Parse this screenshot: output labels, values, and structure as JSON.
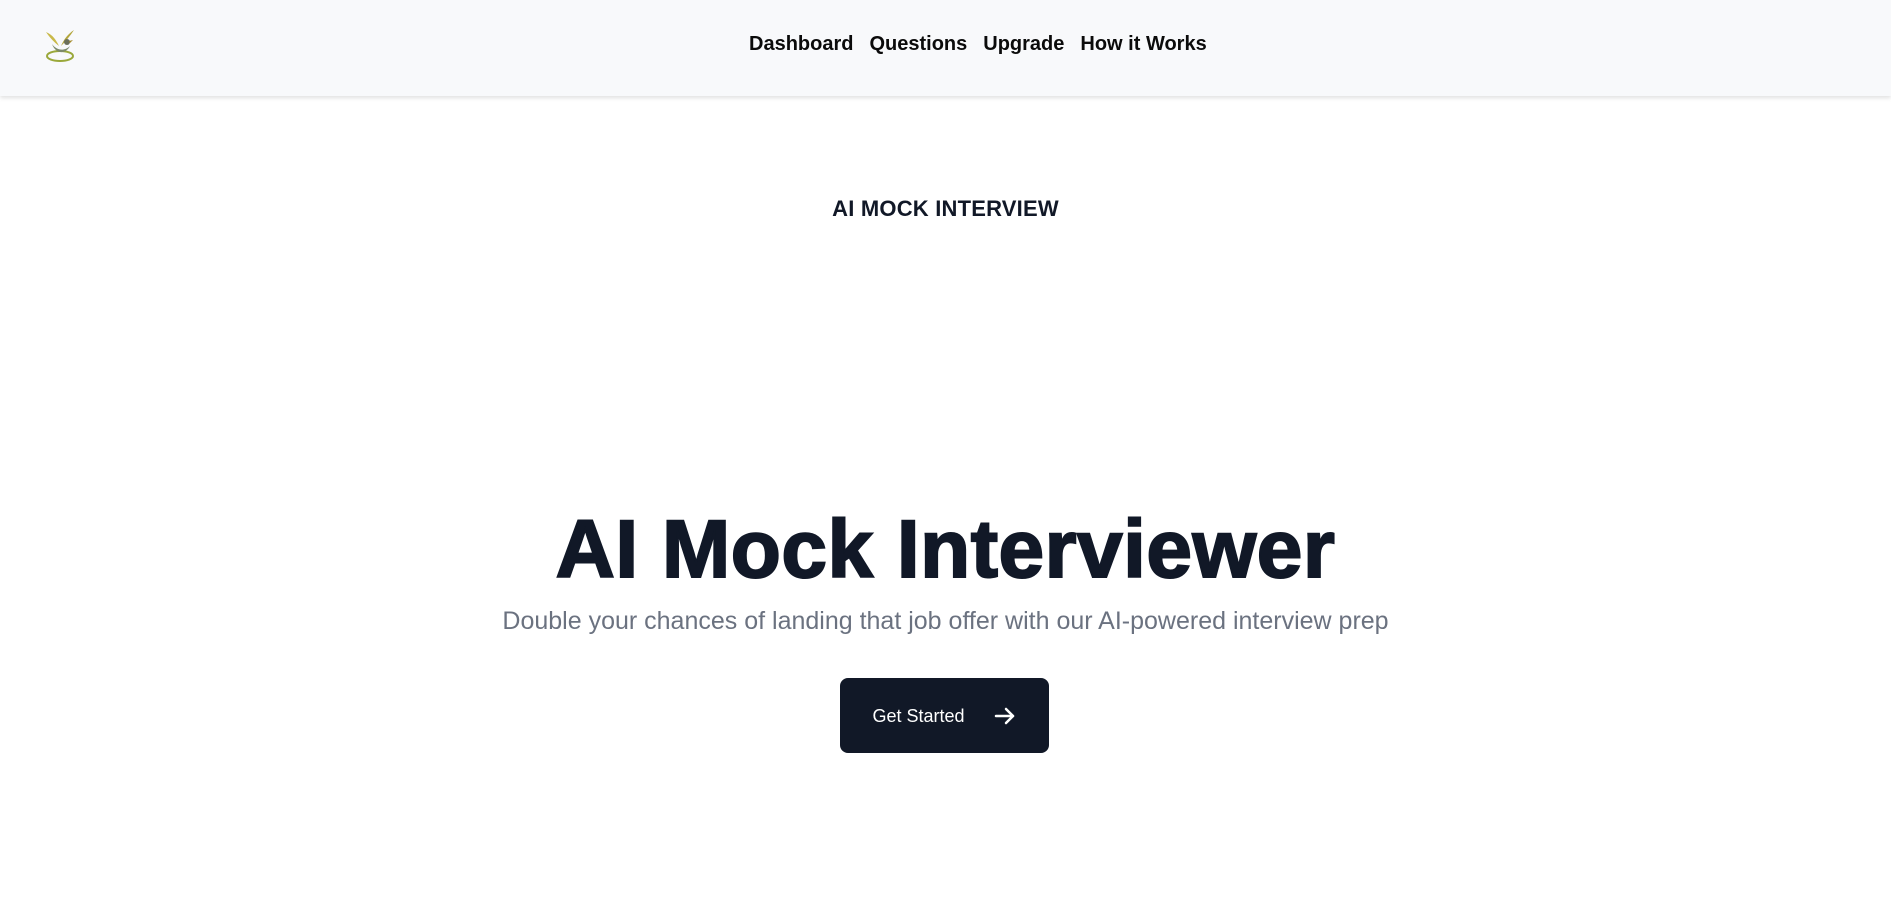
{
  "header": {
    "logo_icon": "dove-emblem-icon",
    "nav": [
      {
        "label": "Dashboard"
      },
      {
        "label": "Questions"
      },
      {
        "label": "Upgrade"
      },
      {
        "label": "How it Works"
      }
    ]
  },
  "hero": {
    "eyebrow": "AI MOCK INTERVIEW",
    "title": "AI Mock Interviewer",
    "subtitle": "Double your chances of landing that job offer with our AI-powered interview prep",
    "cta_label": "Get Started",
    "cta_icon": "arrow-right-icon"
  },
  "colors": {
    "header_bg": "#f8f9fb",
    "text_dark": "#111827",
    "text_muted": "#6b7280",
    "button_bg": "#111827",
    "button_text": "#ffffff"
  }
}
